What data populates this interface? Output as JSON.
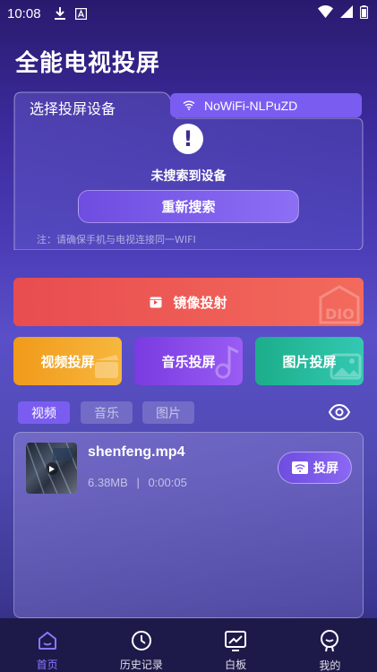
{
  "status_bar": {
    "time": "10:08"
  },
  "app": {
    "title": "全能电视投屏"
  },
  "device_card": {
    "label": "选择投屏设备",
    "wifi_name": "NoWiFi-NLPuZD",
    "alert_symbol": "!",
    "not_found": "未搜索到设备",
    "research_label": "重新搜索",
    "note": "注：请确保手机与电视连接同一WIFI"
  },
  "actions": {
    "mirror_label": "镜像投射",
    "video_label": "视频投屏",
    "music_label": "音乐投屏",
    "photo_label": "图片投屏"
  },
  "media_tabs": [
    {
      "label": "视频",
      "active": true
    },
    {
      "label": "音乐",
      "active": false
    },
    {
      "label": "图片",
      "active": false
    }
  ],
  "files": [
    {
      "name": "shenfeng.mp4",
      "size": "6.38MB",
      "separator": "|",
      "duration": "0:00:05",
      "cast_label": "投屏"
    }
  ],
  "bottom_nav": [
    {
      "label": "首页",
      "icon": "home-icon",
      "active": true
    },
    {
      "label": "历史记录",
      "icon": "clock-icon",
      "active": false
    },
    {
      "label": "白板",
      "icon": "chart-board-icon",
      "active": false
    },
    {
      "label": "我的",
      "icon": "profile-icon",
      "active": false
    }
  ],
  "colors": {
    "accent": "#7a5df0",
    "mirror": "#e84c4f",
    "video": "#f19a1a",
    "music": "#7a3be0",
    "photo": "#1cae8a",
    "nav_active": "#8a78ff"
  }
}
